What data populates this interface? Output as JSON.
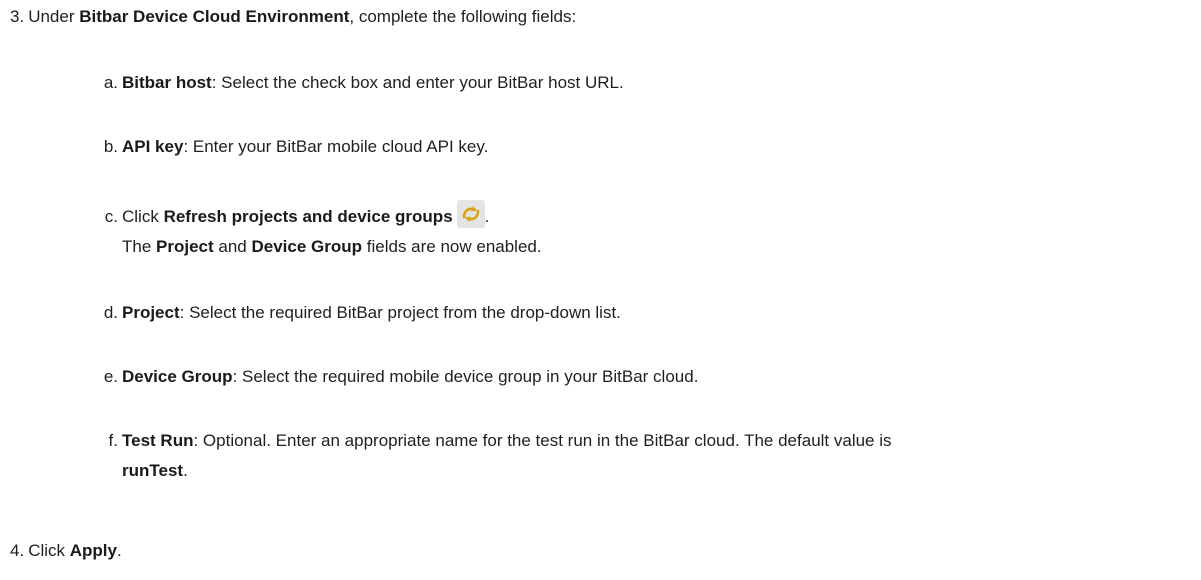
{
  "step3": {
    "number": "3.",
    "prefix": "Under ",
    "bold": "Bitbar Device Cloud Environment",
    "suffix": ", complete the following fields:"
  },
  "items": [
    {
      "marker": "a.",
      "bold": "Bitbar host",
      "text": ": Select the check box and enter your BitBar host URL."
    },
    {
      "marker": "b.",
      "bold": "API key",
      "text": ": Enter your BitBar mobile cloud API key."
    },
    {
      "marker": "c.",
      "prefix": "Click ",
      "bold": "Refresh projects and device groups",
      "after_icon": ".",
      "icon": "refresh-icon",
      "note_prefix": "The ",
      "note_bold1": "Project",
      "note_mid": " and ",
      "note_bold2": "Device Group",
      "note_suffix": " fields are now enabled."
    },
    {
      "marker": "d.",
      "bold": "Project",
      "text": ": Select the required BitBar project from the drop-down list."
    },
    {
      "marker": "e.",
      "bold": "Device Group",
      "text": ": Select the required mobile device group in your BitBar cloud."
    },
    {
      "marker": "f.",
      "bold": "Test Run",
      "text": ": Optional. Enter an appropriate name for the test run in the BitBar cloud. The default value is",
      "line2_bold": "runTest",
      "line2_suffix": "."
    }
  ],
  "step4": {
    "number": "4.",
    "prefix": "Click ",
    "bold": "Apply",
    "suffix": "."
  }
}
